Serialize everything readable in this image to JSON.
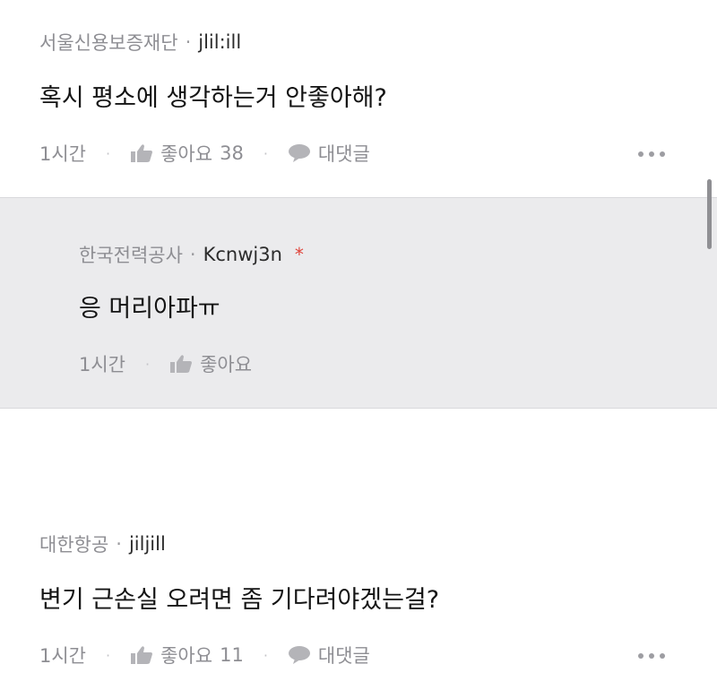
{
  "comments": [
    {
      "org": "서울신용보증재단",
      "nick": "jlil:ill",
      "text": "혹시 평소에 생각하는거 안좋아해?",
      "time": "1시간",
      "like_label": "좋아요",
      "like_count": "38",
      "reply_label": "대댓글"
    },
    {
      "org": "대한항공",
      "nick": "jiljill",
      "text": "변기 근손실 오려면 좀 기다려야겠는걸?",
      "time": "1시간",
      "like_label": "좋아요",
      "like_count": "11",
      "reply_label": "대댓글"
    }
  ],
  "reply": {
    "org": "한국전력공사",
    "nick": "Kcnwj3n",
    "author_mark": "*",
    "text": "응 머리아파ㅠ",
    "time": "1시간",
    "like_label": "좋아요"
  },
  "separator": "·",
  "icons": {
    "like": "thumbs-up-icon",
    "reply": "speech-bubble-icon",
    "more": "more-horizontal-icon"
  },
  "colors": {
    "reply_background": "#ebebed",
    "author_mark": "#e0443a",
    "meta_text": "#8e8e93"
  }
}
